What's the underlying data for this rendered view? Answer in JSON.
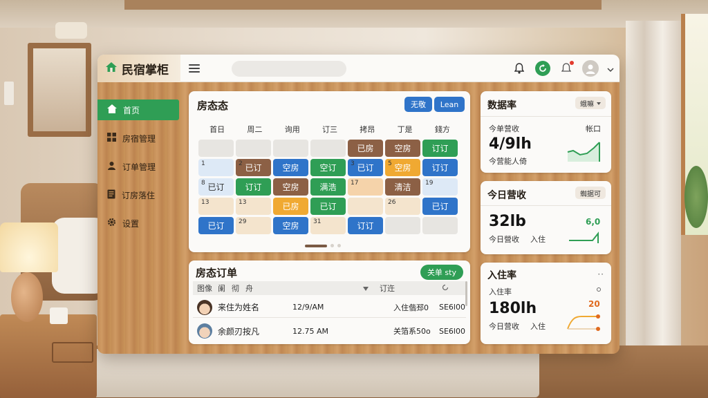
{
  "brand": {
    "name": "民宿掌柜"
  },
  "sidebar": {
    "items": [
      {
        "label": "首页",
        "icon": "home-icon",
        "active": true
      },
      {
        "label": "房宿管理",
        "icon": "grid-icon"
      },
      {
        "label": "订单管理",
        "icon": "user-icon"
      },
      {
        "label": "订房落住",
        "icon": "document-icon"
      },
      {
        "label": "设置",
        "icon": "gear-icon"
      }
    ]
  },
  "room_status": {
    "title": "房态态",
    "btn_primary": "无敬",
    "btn_secondary": "Lean",
    "days": [
      "首日",
      "周二",
      "询用",
      "订三",
      "拷昂",
      "丁是",
      "錢方"
    ],
    "cells": [
      {
        "num": "",
        "text": "",
        "style": "empty"
      },
      {
        "num": "",
        "text": "",
        "style": "empty"
      },
      {
        "num": "",
        "text": "",
        "style": "empty"
      },
      {
        "num": "",
        "text": "",
        "style": "empty"
      },
      {
        "num": "",
        "text": "已房",
        "style": "brown"
      },
      {
        "num": "",
        "text": "空房",
        "style": "brown"
      },
      {
        "num": "",
        "text": "订订",
        "style": "green"
      },
      {
        "num": "1",
        "text": "",
        "style": "lblue"
      },
      {
        "num": "2",
        "text": "已订",
        "style": "brown"
      },
      {
        "num": "",
        "text": "空房",
        "style": "blue"
      },
      {
        "num": "",
        "text": "空订",
        "style": "green"
      },
      {
        "num": "3",
        "text": "已订",
        "style": "blue"
      },
      {
        "num": "5",
        "text": "空房",
        "style": "orange"
      },
      {
        "num": "",
        "text": "订订",
        "style": "blue"
      },
      {
        "num": "8",
        "text": "已订",
        "style": "lblue"
      },
      {
        "num": "",
        "text": "订订",
        "style": "green"
      },
      {
        "num": "",
        "text": "空房",
        "style": "brown"
      },
      {
        "num": "",
        "text": "满浩",
        "style": "green"
      },
      {
        "num": "17",
        "text": "",
        "style": "peach"
      },
      {
        "num": "",
        "text": "清洁",
        "style": "brown"
      },
      {
        "num": "19",
        "text": "",
        "style": "lblue"
      },
      {
        "num": "13",
        "text": "",
        "style": "beige"
      },
      {
        "num": "13",
        "text": "",
        "style": "beige"
      },
      {
        "num": "",
        "text": "已房",
        "style": "orange"
      },
      {
        "num": "",
        "text": "已订",
        "style": "green"
      },
      {
        "num": "",
        "text": "",
        "style": "beige"
      },
      {
        "num": "26",
        "text": "",
        "style": "beige"
      },
      {
        "num": "",
        "text": "已订",
        "style": "blue"
      },
      {
        "num": "",
        "text": "已订",
        "style": "blue"
      },
      {
        "num": "29",
        "text": "",
        "style": "beige"
      },
      {
        "num": "",
        "text": "空房",
        "style": "blue"
      },
      {
        "num": "31",
        "text": "",
        "style": "beige"
      },
      {
        "num": "",
        "text": "订订",
        "style": "blue"
      },
      {
        "num": "",
        "text": "",
        "style": "empty"
      },
      {
        "num": "",
        "text": "",
        "style": "empty"
      }
    ]
  },
  "orders": {
    "title": "房态订单",
    "btn": "关单 sty",
    "header": [
      "图像",
      "阑",
      "彻",
      "舟",
      "订迕"
    ],
    "rows": [
      {
        "name": "来住为姓名",
        "time": "12/9/AM",
        "status": "入住偕邳0",
        "code": "SE6l00"
      },
      {
        "name": "余颜刃按凡",
        "time": "12.75 AM",
        "status": "关箔系50o",
        "code": "SE6l00"
      }
    ]
  },
  "stats": [
    {
      "title": "数据率",
      "tag": "蛾嘛",
      "label_left": "今单营收",
      "label_right": "帐口",
      "value": "4/9lh",
      "sub": "今营能人倚"
    },
    {
      "title": "今日营收",
      "tag": "蜘据可",
      "value": "32lb",
      "sub_left": "今日營收",
      "sub_right": "入住",
      "chart_label": "6,0"
    },
    {
      "title": "入住率",
      "label": "入住率",
      "value": "180lh",
      "sub_left": "今日营收",
      "sub_right": "入住",
      "chart_label": "20"
    }
  ]
}
